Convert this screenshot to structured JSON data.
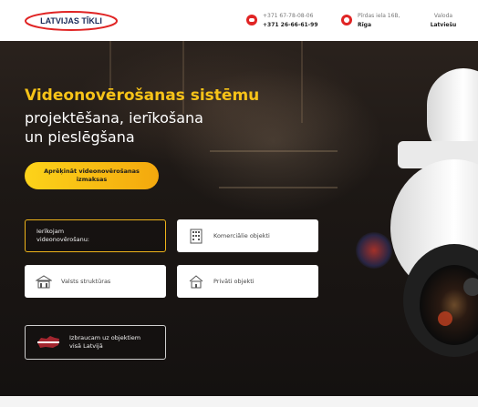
{
  "header": {
    "logo_text": "LATVIJAS TĪKLI",
    "phone_1": "+371 67-78-08-06",
    "phone_2": "+371 26-66-61-99",
    "address_line": "Pīrdas iela 16B,",
    "address_city": "Rīga",
    "lang_label": "Valoda",
    "lang_value": "Latviešu"
  },
  "hero": {
    "title": "Videonovērošanas sistēmu",
    "subtitle_line1": "projektēšana, ierīkošana",
    "subtitle_line2": "un pieslēgšana",
    "cta_line1": "Aprēķināt videonovērošanas",
    "cta_line2": "izmaksas"
  },
  "cards": {
    "install_line1": "Ierīkojam",
    "install_line2": "videonovērošanu:",
    "commercial": "Komerciālie objekti",
    "state": "Valsts struktūras",
    "private": "Privāti objekti",
    "travel_line1": "Izbraucam uz objektiem",
    "travel_line2": "visā Latvijā"
  },
  "colors": {
    "brand_red": "#e02424",
    "accent_yellow": "#f7c318"
  }
}
